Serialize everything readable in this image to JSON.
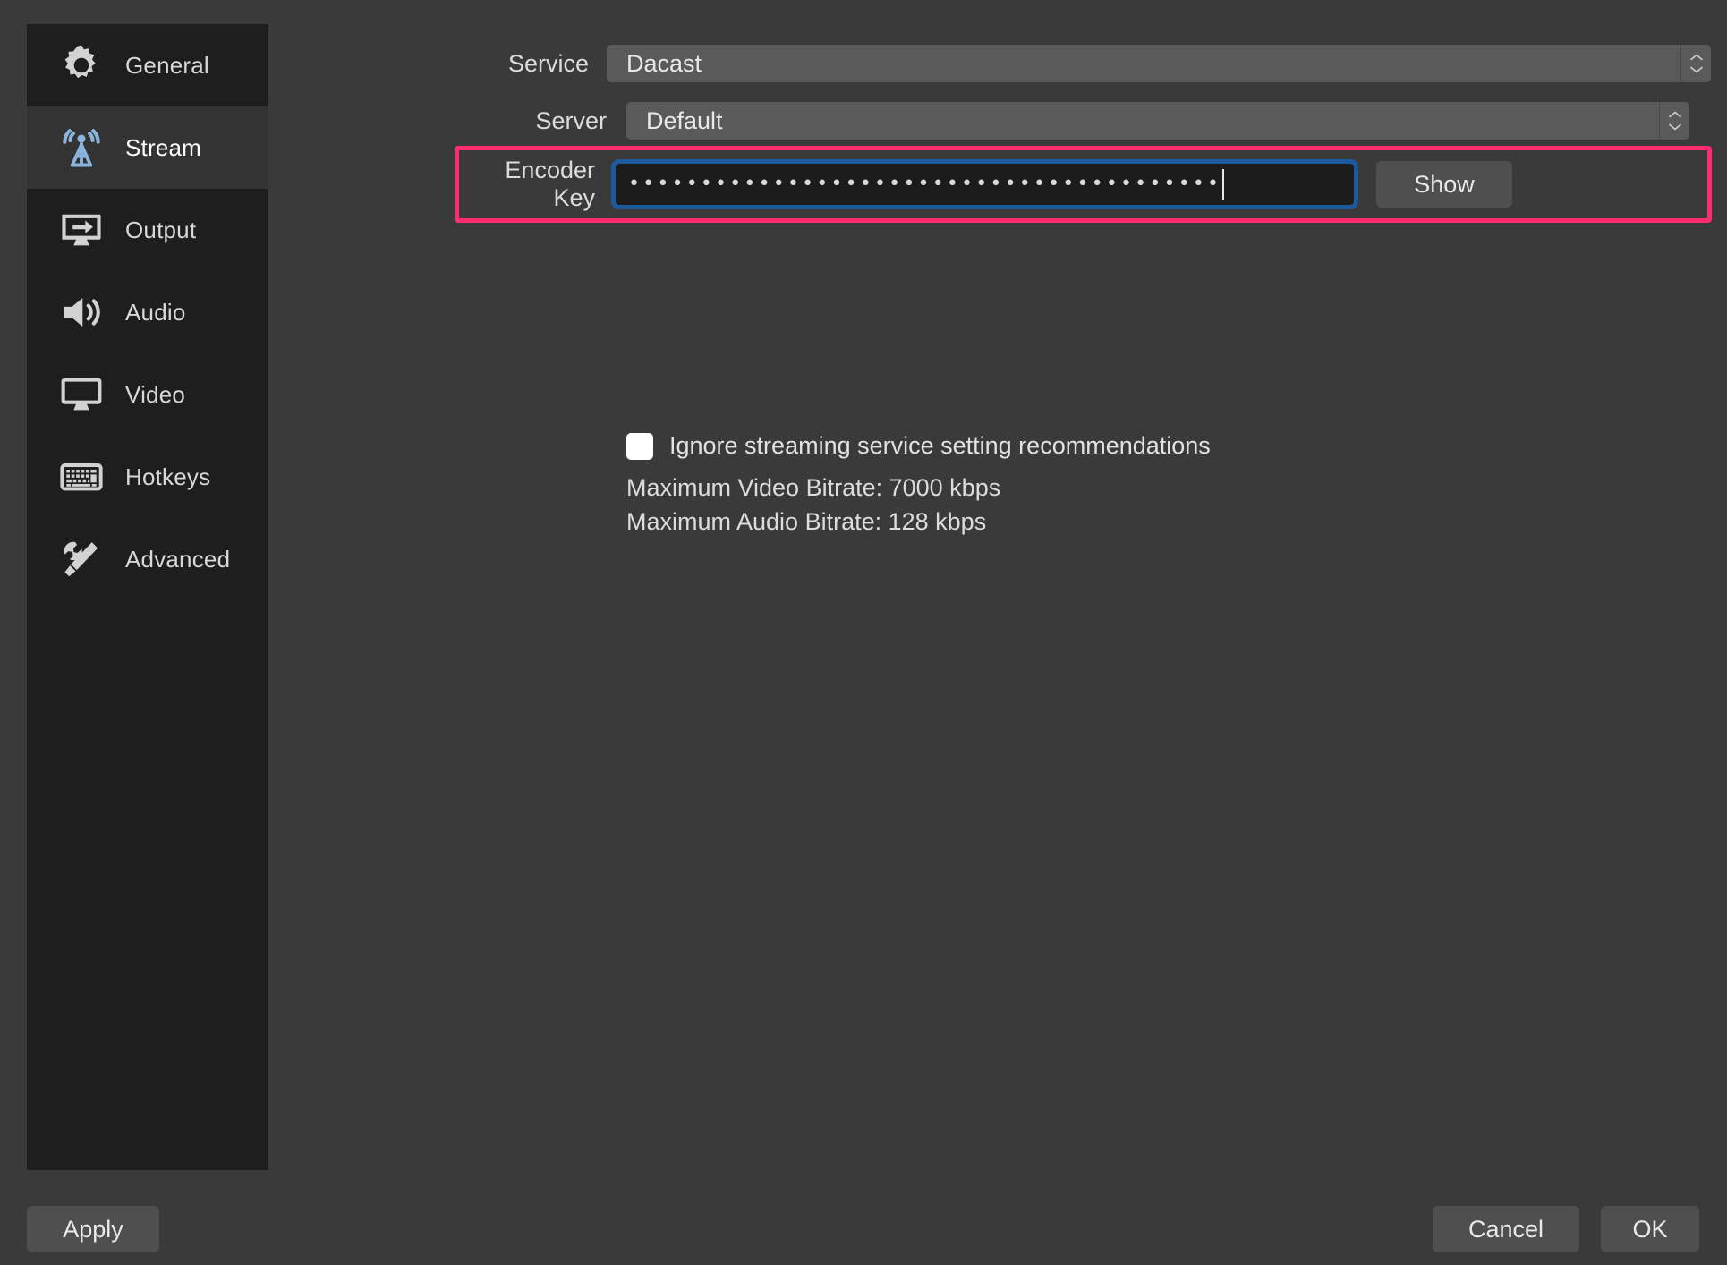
{
  "sidebar": {
    "items": [
      {
        "label": "General",
        "icon": "gear-icon",
        "selected": false
      },
      {
        "label": "Stream",
        "icon": "broadcast-icon",
        "selected": true
      },
      {
        "label": "Output",
        "icon": "output-icon",
        "selected": false
      },
      {
        "label": "Audio",
        "icon": "speaker-icon",
        "selected": false
      },
      {
        "label": "Video",
        "icon": "monitor-icon",
        "selected": false
      },
      {
        "label": "Hotkeys",
        "icon": "keyboard-icon",
        "selected": false
      },
      {
        "label": "Advanced",
        "icon": "tools-icon",
        "selected": false
      }
    ]
  },
  "stream_settings": {
    "service": {
      "label": "Service",
      "value": "Dacast"
    },
    "server": {
      "label": "Server",
      "value": "Default"
    },
    "encoder_key": {
      "label": "Encoder Key",
      "masked_value": "•••••••••••••••••••••••••••••••••••••••••",
      "show_button_label": "Show"
    },
    "ignore_recommendations": {
      "label": "Ignore streaming service setting recommendations",
      "checked": false
    },
    "max_video_bitrate": "Maximum Video Bitrate: 7000 kbps",
    "max_audio_bitrate": "Maximum Audio Bitrate: 128 kbps"
  },
  "footer": {
    "apply_label": "Apply",
    "cancel_label": "Cancel",
    "ok_label": "OK"
  },
  "colors": {
    "window_bg": "#3a3a3a",
    "sidebar_bg": "#1e1e1e",
    "sidebar_selected_bg": "#333333",
    "highlight_border": "#ff2d6f",
    "focus_ring": "#1c5a9e",
    "stream_icon": "#8ab4dd"
  }
}
